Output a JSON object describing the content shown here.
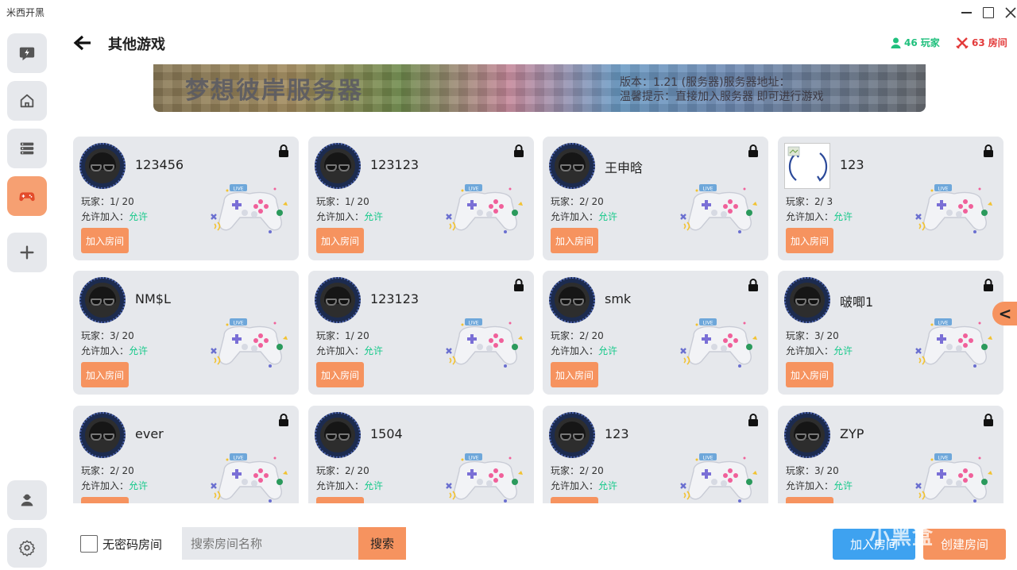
{
  "app": {
    "title": "米西开黑"
  },
  "window": {
    "minimize_icon": "minimize-icon",
    "maximize_icon": "maximize-icon",
    "close_icon": "close-icon"
  },
  "sidebar": {
    "items": [
      {
        "icon": "lightning-chat-icon",
        "active": false
      },
      {
        "icon": "home-icon",
        "active": false
      },
      {
        "icon": "server-list-icon",
        "active": false
      },
      {
        "icon": "gamepad-icon",
        "active": true
      },
      {
        "icon": "plus-icon",
        "active": false
      },
      {
        "icon": "user-icon",
        "active": false
      },
      {
        "icon": "settings-icon",
        "active": false
      }
    ]
  },
  "header": {
    "title": "其他游戏",
    "players_count": "46",
    "players_label": "玩家",
    "rooms_count": "63",
    "rooms_label": "房间"
  },
  "banner": {
    "title": "梦想彼岸服务器",
    "line1": "版本：1.21 (服务器)服务器地址：",
    "line2": "温馨提示：直接加入服务器 即可进行游戏"
  },
  "room_labels": {
    "players_prefix": "玩家：",
    "allow_label": "允许加入：",
    "allow_value": "允许",
    "join_label": "加入房间"
  },
  "rooms": [
    {
      "name": "123456",
      "players": "1/ 20",
      "locked": true,
      "avatar": "headset"
    },
    {
      "name": "123123",
      "players": "1/ 20",
      "locked": true,
      "avatar": "headset"
    },
    {
      "name": "王申晗",
      "players": "2/ 20",
      "locked": true,
      "avatar": "headset"
    },
    {
      "name": "123",
      "players": "2/ 3",
      "locked": true,
      "avatar": "broken"
    },
    {
      "name": "NM$L",
      "players": "3/ 20",
      "locked": false,
      "avatar": "headset"
    },
    {
      "name": "123123",
      "players": "1/ 20",
      "locked": true,
      "avatar": "headset"
    },
    {
      "name": "smk",
      "players": "2/ 20",
      "locked": true,
      "avatar": "headset"
    },
    {
      "name": "啵唧1",
      "players": "3/ 20",
      "locked": true,
      "avatar": "headset"
    },
    {
      "name": "ever",
      "players": "2/ 20",
      "locked": true,
      "avatar": "headset"
    },
    {
      "name": "1504",
      "players": "2/ 20",
      "locked": false,
      "avatar": "headset"
    },
    {
      "name": "123",
      "players": "2/ 20",
      "locked": true,
      "avatar": "headset"
    },
    {
      "name": "ZYP",
      "players": "3/ 20",
      "locked": true,
      "avatar": "headset"
    }
  ],
  "collapse": {
    "label": "<"
  },
  "bottom": {
    "no_password_label": "无密码房间",
    "search_placeholder": "搜索房间名称",
    "search_label": "搜索",
    "join_room_label": "加入房间",
    "create_room_label": "创建房间"
  },
  "watermark": "小黑盒",
  "colors": {
    "accent": "#f6935f",
    "blue": "#3ea2f0",
    "players": "#20c07d",
    "rooms": "#e33b3b",
    "allow": "#16c98a",
    "card_bg": "#e6e8ec"
  }
}
